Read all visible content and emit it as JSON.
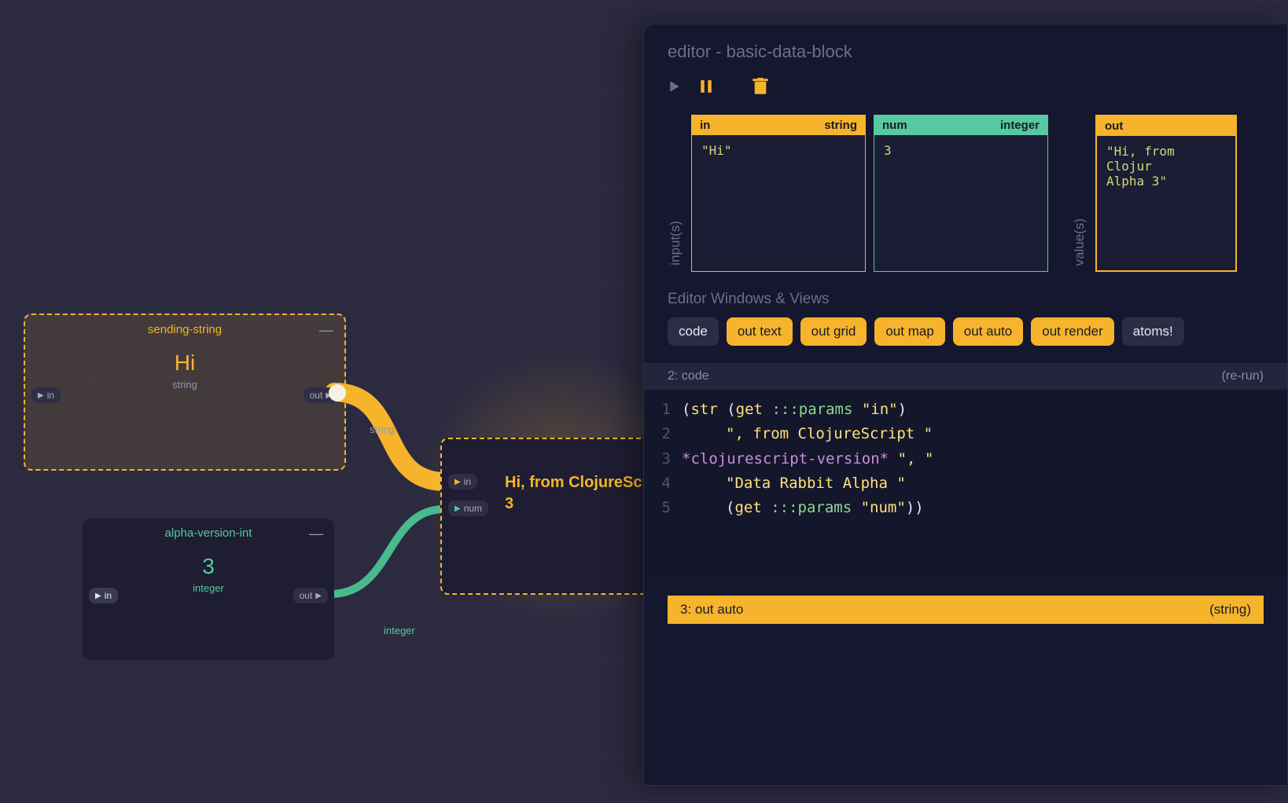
{
  "canvas": {
    "nodes": {
      "sendingString": {
        "title": "sending-string",
        "value": "Hi",
        "type": "string",
        "inPort": "in",
        "outPort": "out"
      },
      "alphaVersionInt": {
        "title": "alpha-version-int",
        "value": "3",
        "type": "integer",
        "inPort": "in",
        "outPort": "out"
      },
      "basicDataBlock": {
        "line1": "Hi, from ClojureScr",
        "line2": "3",
        "portIn": "in",
        "portNum": "num"
      }
    },
    "wireLabels": {
      "string": "string",
      "integer": "integer"
    }
  },
  "editor": {
    "title": "editor - basic-data-block",
    "inputsLabel": "input(s)",
    "valuesLabel": "value(s)",
    "io": {
      "in": {
        "name": "in",
        "type": "string",
        "value": "\"Hi\""
      },
      "num": {
        "name": "num",
        "type": "integer",
        "value": "3"
      },
      "out": {
        "name": "out",
        "value": "\"Hi, from Clojur\nAlpha 3\""
      }
    },
    "sectionLabel": "Editor Windows & Views",
    "viewButtons": {
      "code": "code",
      "outText": "out text",
      "outGrid": "out grid",
      "outMap": "out map",
      "outAuto": "out auto",
      "outRender": "out render",
      "atoms": "atoms!"
    },
    "codeHeader": {
      "left": "2: code",
      "right": "(re-run)"
    },
    "code": {
      "l1": {
        "a": "(",
        "b": "str ",
        "c": "(",
        "d": "get ",
        "e": ":::params ",
        "f": "\"in\"",
        "g": ")"
      },
      "l2": {
        "a": "\", from ClojureScript \""
      },
      "l3": {
        "a": "*clojurescript-version* ",
        "b": "\", \""
      },
      "l4": {
        "a": "\"Data Rabbit Alpha \""
      },
      "l5": {
        "a": "(",
        "b": "get ",
        "c": ":::params ",
        "d": "\"num\"",
        "e": "))"
      }
    },
    "outBar": {
      "left": "3: out auto",
      "right": "(string)"
    }
  }
}
